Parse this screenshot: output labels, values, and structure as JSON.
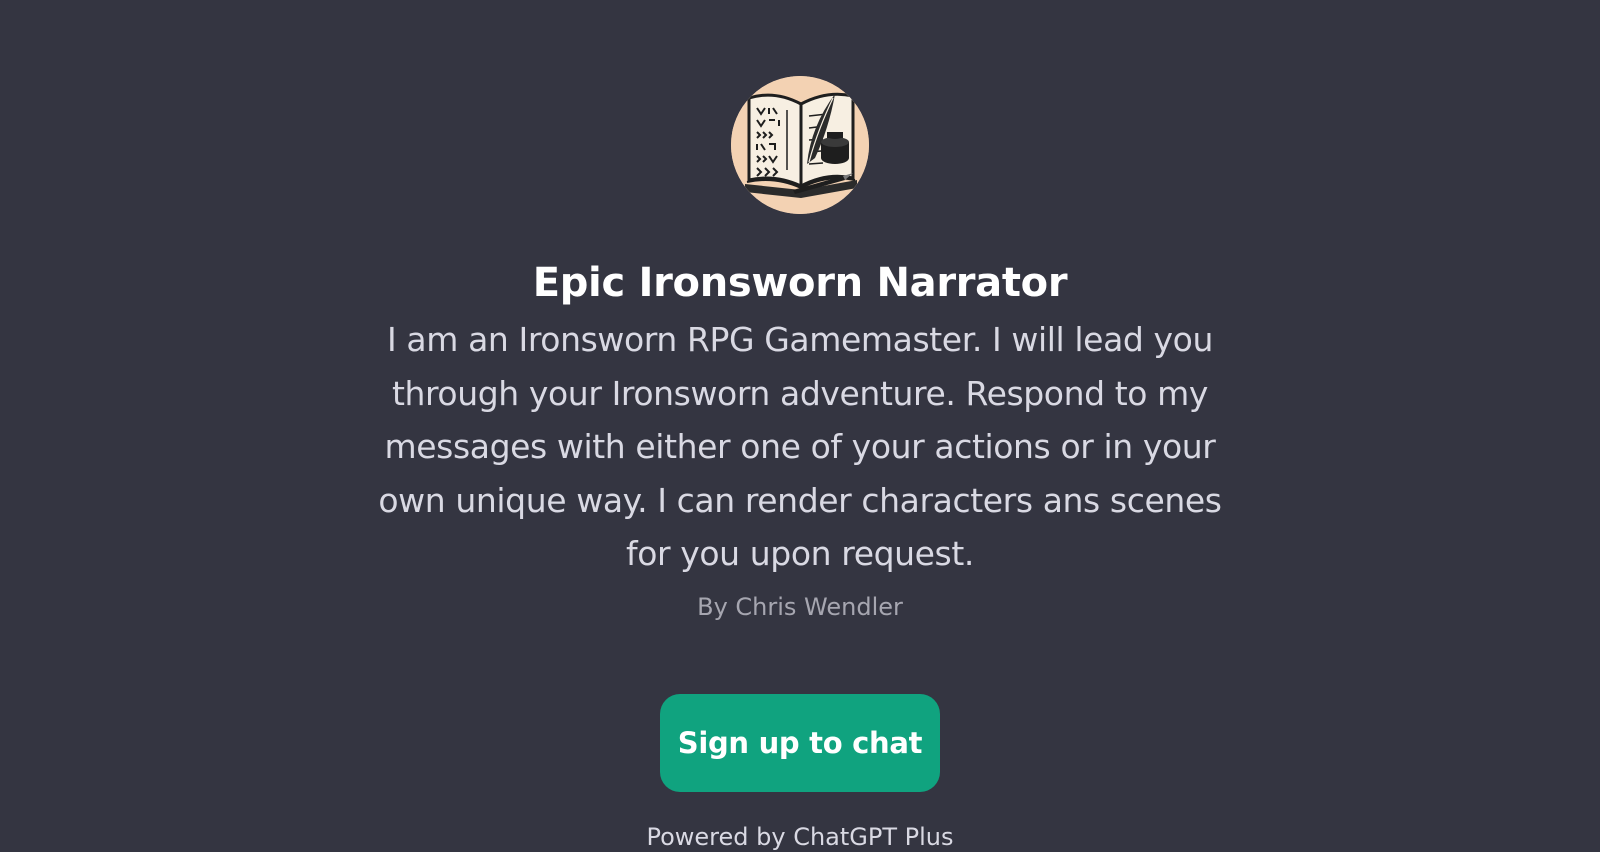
{
  "gpt": {
    "title": "Epic Ironsworn Narrator",
    "description": "I am an Ironsworn RPG Gamemaster. I will lead you through your Ironsworn adventure. Respond to my messages with either one of your actions or in your own unique way. I can render characters ans scenes for you upon request.",
    "author": "By Chris Wendler",
    "avatar_icon": "open-book-quill-icon"
  },
  "cta": {
    "signup_label": "Sign up to chat"
  },
  "footer": {
    "text": "Powered by ChatGPT Plus"
  },
  "colors": {
    "background": "#343541",
    "accent": "#10a37f",
    "title": "#ffffff",
    "body_text": "#d9d9e3",
    "muted_text": "#a6a6b0"
  }
}
